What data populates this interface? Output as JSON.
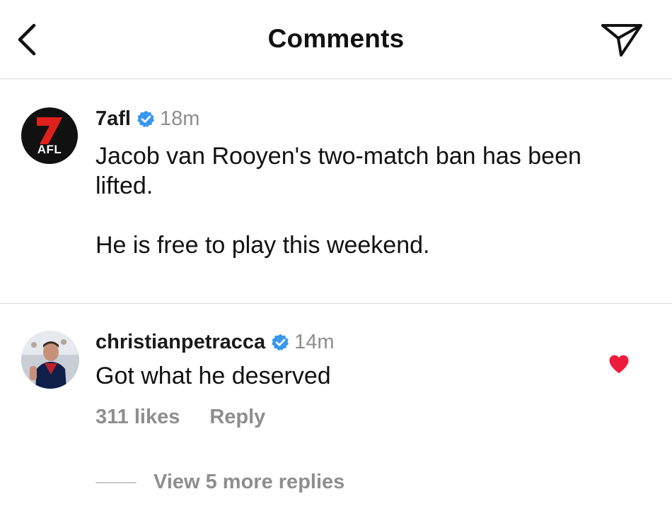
{
  "header": {
    "title": "Comments",
    "back_icon": "chevron-left-icon",
    "send_icon": "paper-plane-icon"
  },
  "post": {
    "avatar_label": "AFL",
    "username": "7afl",
    "verified": true,
    "time": "18m",
    "caption_line1": "Jacob van Rooyen's two-match ban has been lifted.",
    "caption_line2": "He is free to play this weekend."
  },
  "comment": {
    "username": "christianpetracca",
    "verified": true,
    "time": "14m",
    "text": "Got what he deserved",
    "likes": "311 likes",
    "reply_label": "Reply",
    "liked_by_author": true,
    "view_more": "View 5 more replies"
  },
  "colors": {
    "verified_blue": "#3897f0",
    "heart_red": "#ed1c3a",
    "secondary_text": "#8e8e8e",
    "seven_red": "#e0201c"
  }
}
